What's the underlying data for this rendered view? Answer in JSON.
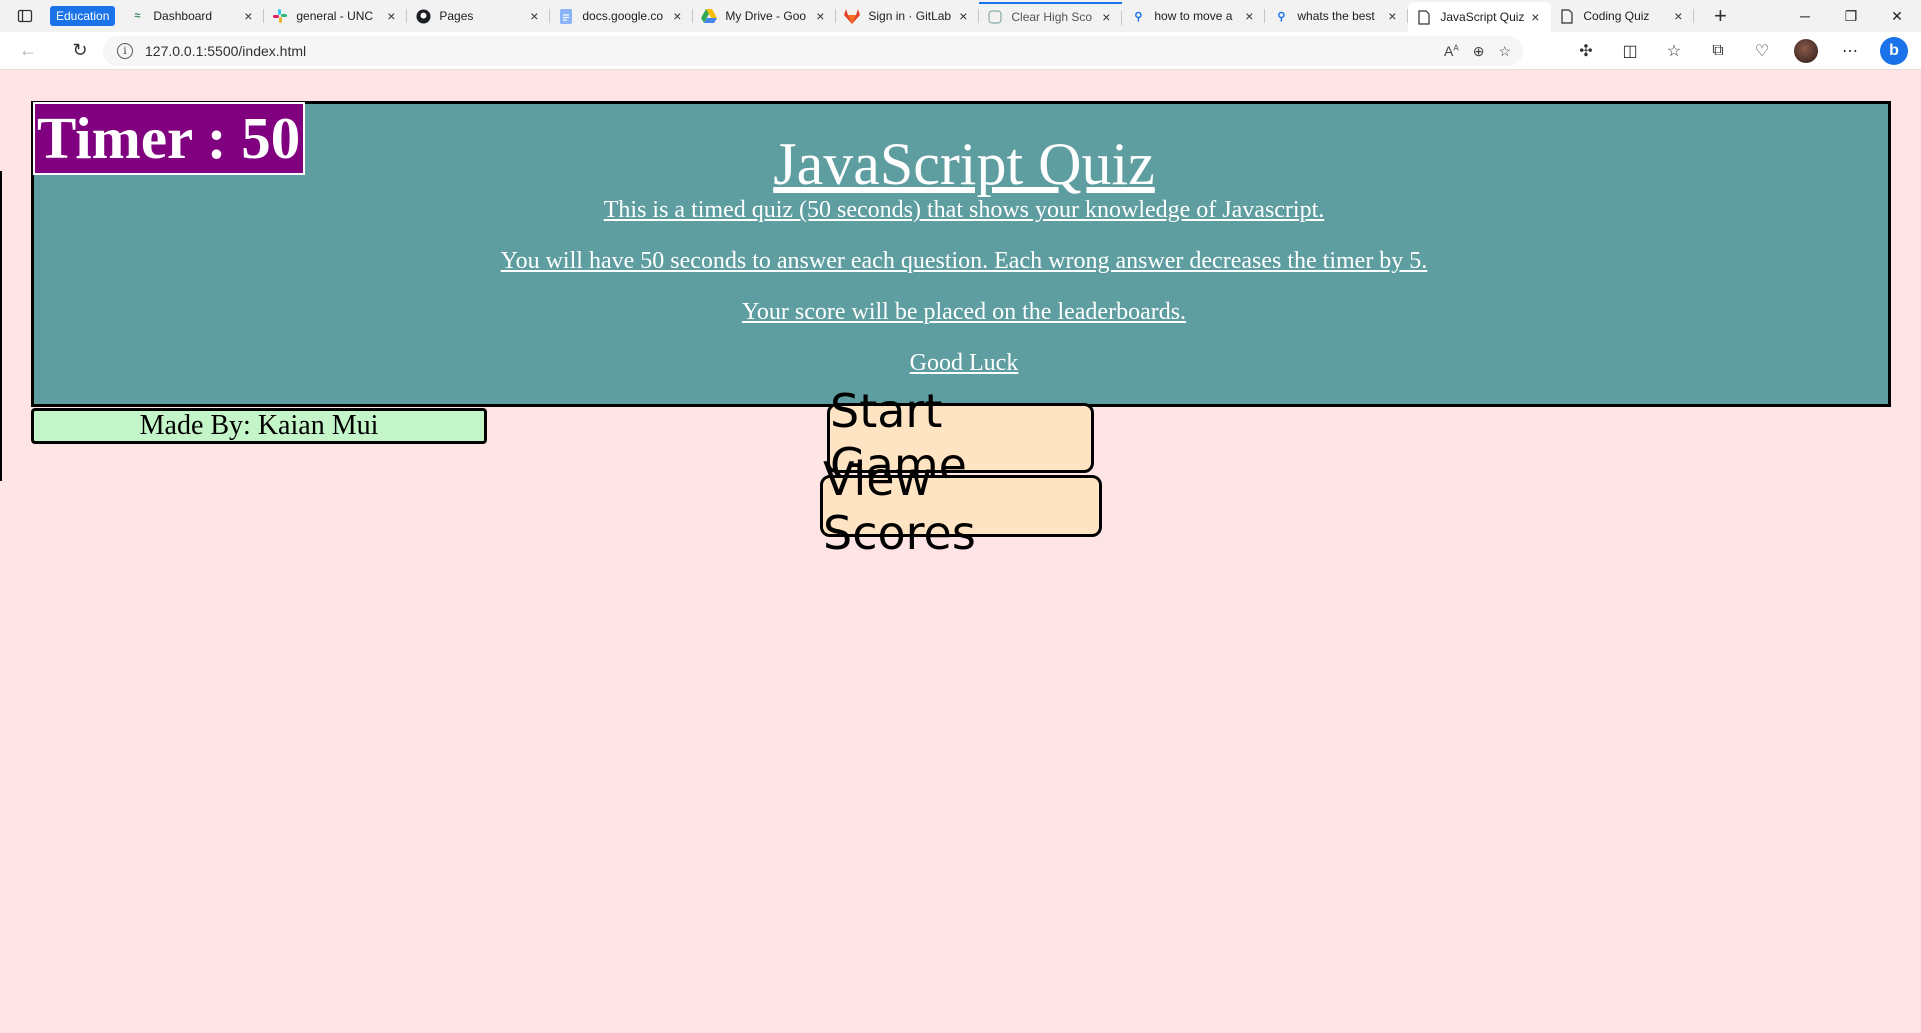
{
  "browser": {
    "tab_group": "Education",
    "tabs": [
      {
        "title": "Dashboard",
        "icon": "dashboard-icon"
      },
      {
        "title": "general - UNC",
        "icon": "slack-icon"
      },
      {
        "title": "Pages",
        "icon": "github-icon"
      },
      {
        "title": "docs.google.co",
        "icon": "google-docs-icon"
      },
      {
        "title": "My Drive - Goo",
        "icon": "google-drive-icon"
      },
      {
        "title": "Sign in · GitLab",
        "icon": "gitlab-icon"
      },
      {
        "title": "Clear High Sco",
        "icon": "page-icon"
      },
      {
        "title": "how to move a",
        "icon": "search-icon"
      },
      {
        "title": "whats the best",
        "icon": "search-icon"
      },
      {
        "title": "JavaScript Quiz",
        "icon": "page-icon",
        "active": true
      },
      {
        "title": "Coding Quiz",
        "icon": "page-icon"
      }
    ],
    "url": "127.0.0.1:5500/index.html"
  },
  "quiz": {
    "timer": "Timer : 50",
    "title": "JavaScript Quiz",
    "lines": [
      "This is a timed quiz (50 seconds) that shows your knowledge of Javascript.",
      "You will have 50 seconds to answer each question. Each wrong answer decreases the timer by 5.",
      "Your score will be placed on the leaderboards.",
      "Good Luck"
    ],
    "made_by": "Made By: Kaian Mui",
    "start_button": "Start Game",
    "scores_button": "View Scores"
  },
  "colors": {
    "page_bg": "#ffe4e6",
    "panel_bg": "#5f9ea0",
    "timer_bg": "#800080",
    "made_by_bg": "#c4f5c8",
    "button_bg": "#ffe4c4"
  }
}
